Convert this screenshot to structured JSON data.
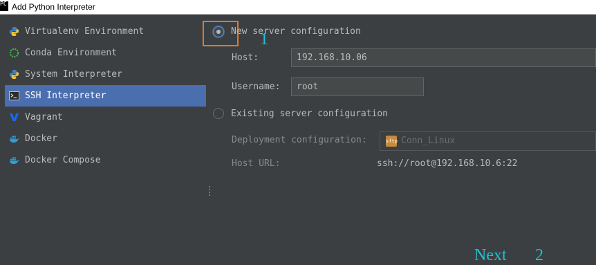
{
  "window": {
    "icon_text": "PC",
    "title": "Add Python Interpreter"
  },
  "sidebar": {
    "items": [
      {
        "label": "Virtualenv Environment",
        "icon": "python-icon",
        "selected": false
      },
      {
        "label": "Conda Environment",
        "icon": "conda-icon",
        "selected": false
      },
      {
        "label": "System Interpreter",
        "icon": "python-icon",
        "selected": false
      },
      {
        "label": "SSH Interpreter",
        "icon": "terminal-icon",
        "selected": true
      },
      {
        "label": "Vagrant",
        "icon": "vagrant-icon",
        "selected": false
      },
      {
        "label": "Docker",
        "icon": "docker-icon",
        "selected": false
      },
      {
        "label": "Docker Compose",
        "icon": "docker-icon",
        "selected": false
      }
    ]
  },
  "new_server": {
    "option_label": "New server configuration",
    "selected": true,
    "host_label": "Host:",
    "host_value": "192.168.10.06",
    "username_label": "Username:",
    "username_value": "root"
  },
  "existing_server": {
    "option_label": "Existing server configuration",
    "selected": false,
    "deployment_label": "Deployment configuration:",
    "deployment_icon_text": "sftp",
    "deployment_value": "Conn_Linux",
    "host_url_label": "Host URL:",
    "host_url_value": "ssh://root@192.168.10.6:22"
  },
  "annotations": {
    "step1": "1",
    "next": "Next",
    "step2": "2",
    "color": "#22c0d4",
    "highlight_color": "#e07a2a"
  },
  "colors": {
    "selected_bg": "#4b6eaf",
    "panel_bg": "#3c3f41"
  }
}
